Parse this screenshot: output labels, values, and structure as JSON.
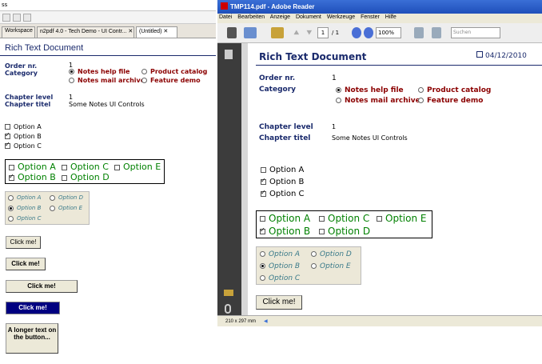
{
  "left": {
    "topbar_text": "ss",
    "tabs": [
      {
        "label": "Workspace"
      },
      {
        "label": "n2pdf 4.0 - Tech Demo - UI Contr..."
      },
      {
        "label": "(Untitled)"
      }
    ],
    "title": "Rich Text Document"
  },
  "doc": {
    "order_label": "Order nr.",
    "order_value": "1",
    "category_label": "Category",
    "categories": [
      "Notes help file",
      "Product catalog",
      "Notes mail archive",
      "Feature demo"
    ],
    "chapter_level_label": "Chapter level",
    "chapter_level_value": "1",
    "chapter_titel_label": "Chapter titel",
    "chapter_titel_value": "Some Notes UI Controls",
    "options": [
      "Option A",
      "Option B",
      "Option C"
    ],
    "big_options": [
      "Option A",
      "Option C",
      "Option E",
      "Option B",
      "Option D"
    ],
    "radio_options": [
      "Option A",
      "Option D",
      "Option B",
      "Option E",
      "Option C"
    ],
    "click_label": "Click me!",
    "longer_label": "A longer text on the button..."
  },
  "reader": {
    "title": "TMP114.pdf - Adobe Reader",
    "menu": [
      "Datei",
      "Bearbeiten",
      "Anzeige",
      "Dokument",
      "Werkzeuge",
      "Fenster",
      "Hilfe"
    ],
    "page_current": "1",
    "page_total": "/ 1",
    "zoom": "100%",
    "search_placeholder": "Suchen",
    "date": "04/12/2010",
    "page_size": "210 x 297 mm"
  }
}
